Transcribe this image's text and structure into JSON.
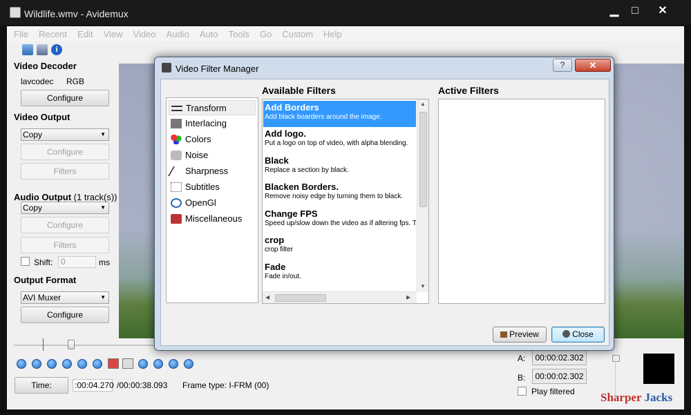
{
  "window": {
    "title": "Wildlife.wmv - Avidemux",
    "min": "▁",
    "max": "□",
    "close": "✕"
  },
  "menu": [
    "File",
    "Recent",
    "Edit",
    "View",
    "Video",
    "Audio",
    "Auto",
    "Tools",
    "Go",
    "Custom",
    "Help"
  ],
  "toolbar": {
    "icons": [
      "open-icon",
      "save-icon",
      "info-icon"
    ]
  },
  "video_decoder": {
    "title": "Video Decoder",
    "codec": "lavcodec",
    "format": "RGB",
    "configure": "Configure"
  },
  "video_output": {
    "title": "Video Output",
    "selected": "Copy",
    "configure": "Configure",
    "filters": "Filters"
  },
  "audio_output": {
    "title": "Audio Output",
    "tracks": "(1 track(s))",
    "selected": "Copy",
    "configure": "Configure",
    "filters": "Filters",
    "shift_label": "Shift:",
    "shift_value": "0",
    "shift_unit": "ms"
  },
  "output_format": {
    "title": "Output Format",
    "selected": "AVI Muxer",
    "configure": "Configure"
  },
  "timebar": {
    "time_button": "Time:",
    "current": ":00:04.270",
    "total": "/00:00:38.093",
    "frame_type": "Frame type: I-FRM (00)"
  },
  "markers": {
    "a_label": "A:",
    "a_value": "00:00:02.302",
    "b_label": "B:",
    "b_value": "00:00:02.302",
    "play_filtered": "Play filtered"
  },
  "watermark": {
    "part1": "Sharper",
    "part2": "Jacks"
  },
  "dialog": {
    "title": "Video Filter Manager",
    "help": "?",
    "close_x": "✕",
    "categories": [
      "Transform",
      "Interlacing",
      "Colors",
      "Noise",
      "Sharpness",
      "Subtitles",
      "OpenGl",
      "Miscellaneous"
    ],
    "selected_category": "Transform",
    "available_header": "Available Filters",
    "active_header": "Active Filters",
    "filters": [
      {
        "name": "Add Borders",
        "desc": "Add black boarders around the image."
      },
      {
        "name": "Add logo.",
        "desc": "Put a logo on top of video, with alpha blending."
      },
      {
        "name": "Black",
        "desc": "Replace a section by black."
      },
      {
        "name": "Blacken Borders.",
        "desc": "Remove noisy edge by turning them to black."
      },
      {
        "name": "Change FPS",
        "desc": "Speed up/slow down the video as if altering fps. Th"
      },
      {
        "name": "crop",
        "desc": "crop filter"
      },
      {
        "name": "Fade",
        "desc": "Fade in/out."
      }
    ],
    "selected_filter": "Add Borders",
    "preview_button": "Preview",
    "close_button": "Close"
  }
}
